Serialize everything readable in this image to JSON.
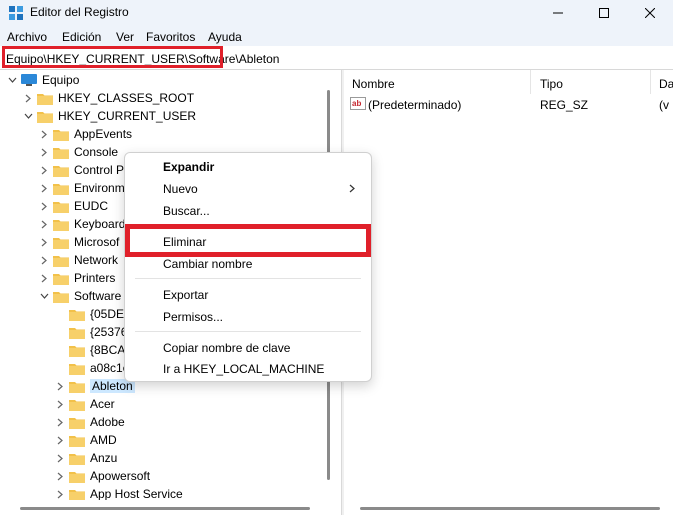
{
  "window": {
    "title": "Editor del Registro"
  },
  "menubar": [
    "Archivo",
    "Edición",
    "Ver",
    "Favoritos",
    "Ayuda"
  ],
  "address": {
    "path": "Equipo\\HKEY_CURRENT_USER\\Software\\Ableton"
  },
  "tree": {
    "root": "Equipo",
    "hkcr": "HKEY_CLASSES_ROOT",
    "hkcu": "HKEY_CURRENT_USER",
    "hkcu_children": [
      "AppEvents",
      "Console",
      "Control P",
      "Environm",
      "EUDC",
      "Keyboard",
      "Microsof",
      "Network",
      "Printers"
    ],
    "software": "Software",
    "software_children": [
      "{05DE9",
      "{25376",
      "{8BCA",
      "a08c1c",
      "Ableton",
      "Acer",
      "Adobe",
      "AMD",
      "Anzu",
      "Apowersoft",
      "App Host Service"
    ]
  },
  "list": {
    "columns": [
      "Nombre",
      "Tipo",
      "Da"
    ],
    "rows": [
      {
        "name": "(Predeterminado)",
        "type": "REG_SZ",
        "data": "(v"
      }
    ]
  },
  "context_menu": {
    "items": [
      {
        "label": "Expandir",
        "bold": true
      },
      {
        "label": "Nuevo",
        "submenu": true
      },
      {
        "label": "Buscar..."
      },
      {
        "label": "Eliminar"
      },
      {
        "label": "Cambiar nombre"
      },
      {
        "label": "Exportar"
      },
      {
        "label": "Permisos..."
      },
      {
        "label": "Copiar nombre de clave"
      },
      {
        "label": "Ir a HKEY_LOCAL_MACHINE"
      }
    ]
  },
  "colors": {
    "highlight": "#e0202a",
    "folder": "#f2c14a",
    "selection": "#cde8ff",
    "titlebar": "#eef3fa"
  }
}
